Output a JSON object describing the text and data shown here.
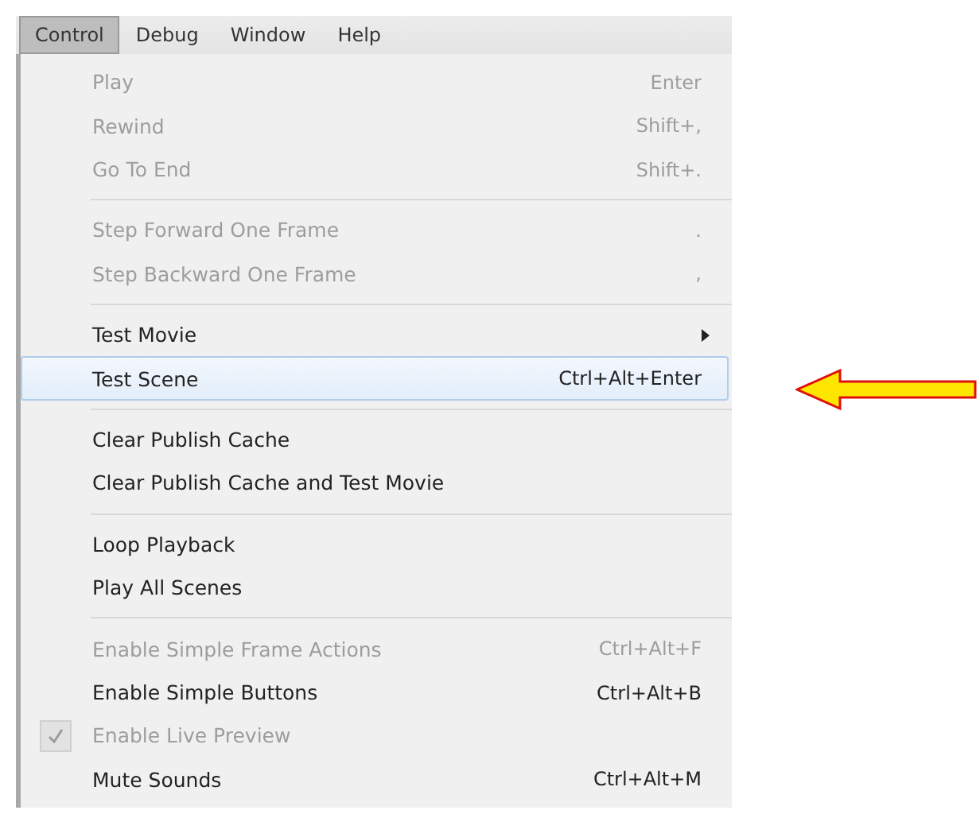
{
  "menubar": [
    {
      "label": "Control",
      "selected": true
    },
    {
      "label": "Debug",
      "selected": false
    },
    {
      "label": "Window",
      "selected": false
    },
    {
      "label": "Help",
      "selected": false
    }
  ],
  "menu": {
    "sections": [
      {
        "items": [
          {
            "label": "Play",
            "shortcut": "Enter",
            "disabled": true,
            "selected": false
          },
          {
            "label": "Rewind",
            "shortcut": "Shift+,",
            "disabled": true,
            "selected": false
          },
          {
            "label": "Go To End",
            "shortcut": "Shift+.",
            "disabled": true,
            "selected": false
          }
        ]
      },
      {
        "items": [
          {
            "label": "Step Forward One Frame",
            "shortcut": ".",
            "disabled": true,
            "selected": false
          },
          {
            "label": "Step Backward One Frame",
            "shortcut": ",",
            "disabled": true,
            "selected": false
          }
        ]
      },
      {
        "items": [
          {
            "label": "Test Movie",
            "submenu": true,
            "disabled": false,
            "selected": false
          },
          {
            "label": "Test Scene",
            "shortcut": "Ctrl+Alt+Enter",
            "disabled": false,
            "selected": true
          }
        ]
      },
      {
        "items": [
          {
            "label": "Clear Publish Cache",
            "disabled": false,
            "selected": false
          },
          {
            "label": "Clear Publish Cache and Test Movie",
            "disabled": false,
            "selected": false
          }
        ]
      },
      {
        "items": [
          {
            "label": "Loop Playback",
            "disabled": false,
            "selected": false
          },
          {
            "label": "Play All Scenes",
            "disabled": false,
            "selected": false
          }
        ]
      },
      {
        "items": [
          {
            "label": "Enable Simple Frame Actions",
            "shortcut": "Ctrl+Alt+F",
            "disabled": true,
            "selected": false
          },
          {
            "label": "Enable Simple Buttons",
            "shortcut": "Ctrl+Alt+B",
            "disabled": false,
            "selected": false
          },
          {
            "label": "Enable Live Preview",
            "disabled": true,
            "checked": true,
            "selected": false
          },
          {
            "label": "Mute Sounds",
            "shortcut": "Ctrl+Alt+M",
            "disabled": false,
            "selected": false
          }
        ]
      }
    ]
  }
}
